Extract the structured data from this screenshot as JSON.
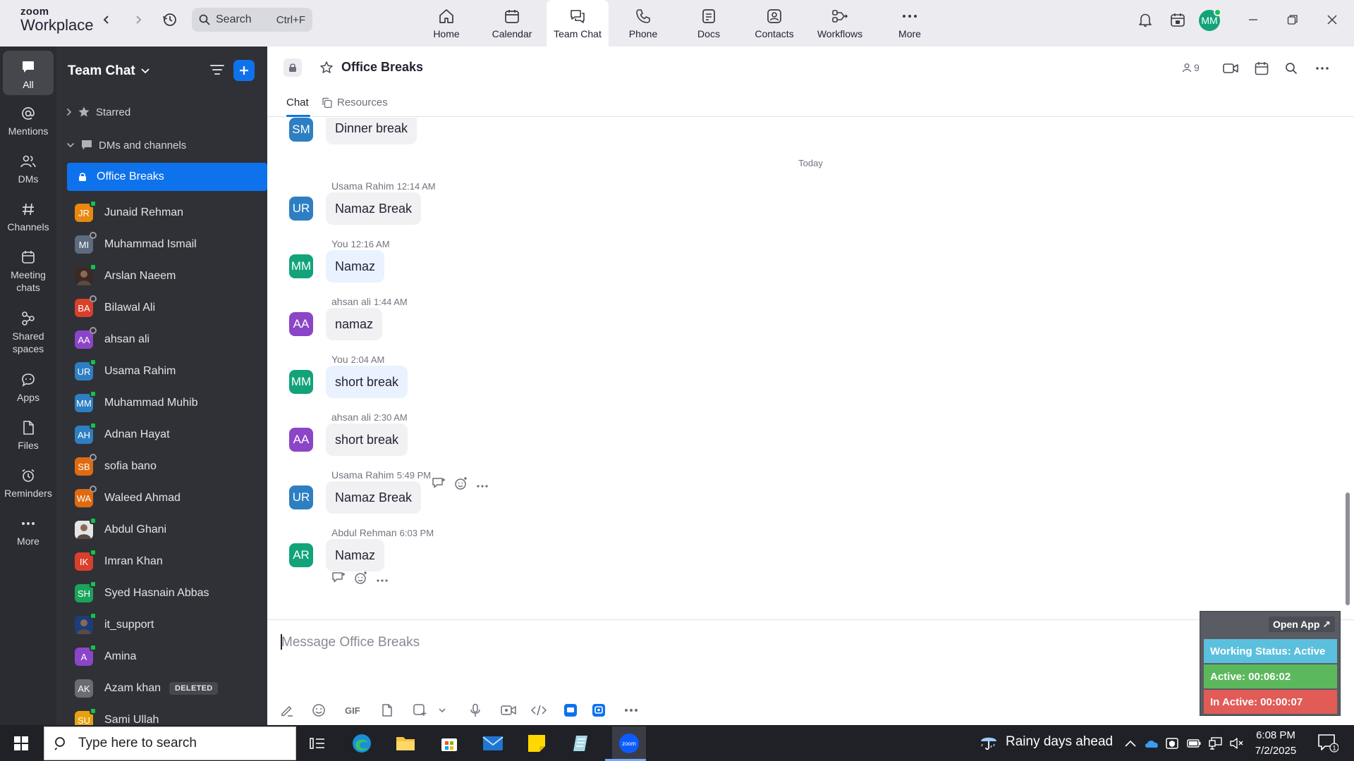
{
  "app": {
    "logo_line1": "zoom",
    "logo_line2": "Workplace"
  },
  "topbar": {
    "search_placeholder": "Search",
    "search_shortcut": "Ctrl+F",
    "user_initials": "MM",
    "tabs": [
      {
        "label": "Home",
        "icon": "home-icon"
      },
      {
        "label": "Calendar",
        "icon": "calendar-icon"
      },
      {
        "label": "Team Chat",
        "icon": "chat-icon"
      },
      {
        "label": "Phone",
        "icon": "phone-icon"
      },
      {
        "label": "Docs",
        "icon": "docs-icon"
      },
      {
        "label": "Contacts",
        "icon": "contacts-icon"
      },
      {
        "label": "Workflows",
        "icon": "workflows-icon"
      },
      {
        "label": "More",
        "icon": "more-icon"
      }
    ],
    "active_tab": "Team Chat"
  },
  "rail": {
    "items": [
      {
        "label": "All",
        "icon": "chat-bubble-icon"
      },
      {
        "label": "Mentions",
        "icon": "at-icon"
      },
      {
        "label": "DMs",
        "icon": "people-icon"
      },
      {
        "label": "Channels",
        "icon": "hash-icon"
      },
      {
        "label": "Meeting chats",
        "icon": "calendar-icon"
      },
      {
        "label": "Shared spaces",
        "icon": "shared-icon"
      },
      {
        "label": "Apps",
        "icon": "apps-icon"
      },
      {
        "label": "Files",
        "icon": "file-icon"
      },
      {
        "label": "Reminders",
        "icon": "alarm-icon"
      },
      {
        "label": "More",
        "icon": "more-icon"
      }
    ]
  },
  "sidebar": {
    "title": "Team Chat",
    "starred_label": "Starred",
    "dms_label": "DMs and channels",
    "selected_channel": "Office Breaks",
    "contacts": [
      {
        "initials": "JR",
        "name": "Junaid Rehman",
        "color": "#e8880e",
        "status": "online"
      },
      {
        "initials": "MI",
        "name": "Muhammad Ismail",
        "color": "#5c6b7d",
        "status": "away"
      },
      {
        "initials": "",
        "name": "Arslan Naeem",
        "color": "#3b2a24",
        "status": "online",
        "photo": true
      },
      {
        "initials": "BA",
        "name": "Bilawal Ali",
        "color": "#d9402b",
        "status": "away"
      },
      {
        "initials": "AA",
        "name": "ahsan ali",
        "color": "#8b45c7",
        "status": "away"
      },
      {
        "initials": "UR",
        "name": "Usama Rahim",
        "color": "#2e7fc2",
        "status": "online"
      },
      {
        "initials": "MM",
        "name": "Muhammad Muhib",
        "color": "#2e7fc2",
        "status": "online"
      },
      {
        "initials": "AH",
        "name": "Adnan Hayat",
        "color": "#2e7fc2",
        "status": "online"
      },
      {
        "initials": "SB",
        "name": "sofia bano",
        "color": "#e06a10",
        "status": "away"
      },
      {
        "initials": "WA",
        "name": "Waleed Ahmad",
        "color": "#e06a10",
        "status": "away"
      },
      {
        "initials": "",
        "name": "Abdul Ghani",
        "color": "#e5e5e5",
        "status": "online",
        "photo": true
      },
      {
        "initials": "IK",
        "name": "Imran Khan",
        "color": "#d9402b",
        "status": "online"
      },
      {
        "initials": "SH",
        "name": "Syed Hasnain Abbas",
        "color": "#1aa35a",
        "status": "online"
      },
      {
        "initials": "",
        "name": "it_support",
        "color": "#1d3d7a",
        "status": "online",
        "photo": true
      },
      {
        "initials": "A",
        "name": "Amina",
        "color": "#8b45c7",
        "status": "online"
      },
      {
        "initials": "AK",
        "name": "Azam khan",
        "color": "#6b6b72",
        "status": "none",
        "badge": "DELETED"
      },
      {
        "initials": "SU",
        "name": "Sami Ullah",
        "color": "#e8a20e",
        "status": "online"
      }
    ]
  },
  "channel": {
    "title": "Office Breaks",
    "member_count": "9",
    "tabs": [
      {
        "label": "Chat"
      },
      {
        "label": "Resources"
      }
    ]
  },
  "messages": {
    "top_partial": {
      "initials": "SM",
      "color": "#2e7fc2",
      "text": "Dinner break"
    },
    "day_separator": "Today",
    "items": [
      {
        "initials": "UR",
        "color": "#2e7fc2",
        "sender": "Usama Rahim",
        "time": "12:14 AM",
        "text": "Namaz Break",
        "mine": false
      },
      {
        "initials": "MM",
        "color": "#12a37a",
        "sender": "You",
        "time": "12:16 AM",
        "text": "Namaz",
        "mine": true
      },
      {
        "initials": "AA",
        "color": "#8b45c7",
        "sender": "ahsan ali",
        "time": "1:44 AM",
        "text": "namaz",
        "mine": false
      },
      {
        "initials": "MM",
        "color": "#12a37a",
        "sender": "You",
        "time": "2:04 AM",
        "text": "short break",
        "mine": true
      },
      {
        "initials": "AA",
        "color": "#8b45c7",
        "sender": "ahsan ali",
        "time": "2:30 AM",
        "text": "short break",
        "mine": false
      },
      {
        "initials": "UR",
        "color": "#2e7fc2",
        "sender": "Usama Rahim",
        "time": "5:49 PM",
        "text": "Namaz Break",
        "mine": false
      },
      {
        "initials": "AR",
        "color": "#12a37a",
        "sender": "Abdul Rehman",
        "time": "6:03 PM",
        "text": "Namaz",
        "mine": false
      }
    ]
  },
  "composer": {
    "placeholder": "Message Office Breaks",
    "gif_label": "GIF"
  },
  "widget": {
    "open_app": "Open App ↗",
    "working_status": "Working Status: Active",
    "active_time": "Active: 00:06:02",
    "inactive_time": "In Active: 00:00:07",
    "colors": {
      "status": "#5bc0de",
      "active": "#5cb85c",
      "inactive": "#e15b57"
    }
  },
  "taskbar": {
    "search_placeholder": "Type here to search",
    "weather": "Rainy days ahead",
    "time": "6:08 PM",
    "date": "7/2/2025",
    "notification_count": "1"
  },
  "colors": {
    "accent": "#0e72ed",
    "rail_bg": "#2a2c31",
    "sidebar_bg": "#2f3136"
  }
}
